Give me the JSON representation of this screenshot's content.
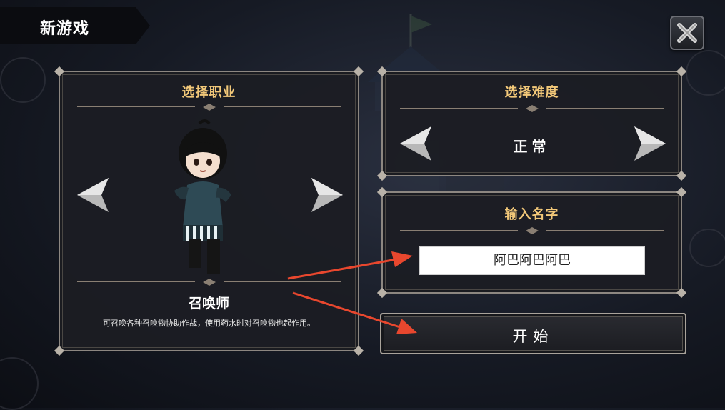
{
  "header": {
    "title": "新游戏"
  },
  "close": {
    "icon": "close-x-icon"
  },
  "class_panel": {
    "title": "选择职业",
    "class_name": "召唤师",
    "description": "可召唤各种召唤物协助作战，使用药水时对召唤物也起作用。",
    "prev_icon": "arrow-left-icon",
    "next_icon": "arrow-right-icon"
  },
  "difficulty_panel": {
    "title": "选择难度",
    "value": "正常",
    "prev_icon": "arrow-left-icon",
    "next_icon": "arrow-right-icon"
  },
  "name_panel": {
    "title": "输入名字",
    "input_value": "阿巴阿巴阿巴"
  },
  "start_button": {
    "label": "开始"
  },
  "colors": {
    "panel_title": "#f2c879",
    "panel_border": "#8d8781",
    "annotation_arrow": "#e8472e"
  }
}
